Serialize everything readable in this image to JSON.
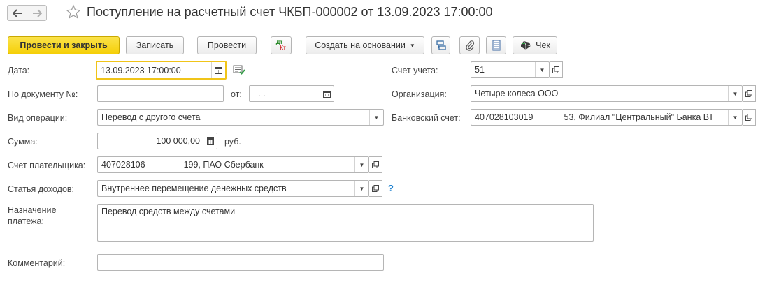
{
  "window": {
    "title": "Поступление на расчетный счет ЧКБП-000002 от 13.09.2023 17:00:00"
  },
  "toolbar": {
    "post_close_label": "Провести и закрыть",
    "save_label": "Записать",
    "post_label": "Провести",
    "dt_label": "Дт",
    "kt_label": "Кт",
    "create_based_label": "Создать на основании",
    "check_label": "Чек"
  },
  "form": {
    "date_label": "Дата:",
    "date_value": "13.09.2023 17:00:00",
    "doc_number_label": "По документу №:",
    "doc_number_value": "",
    "from_label": "от:",
    "from_value": ". .",
    "operation_label": "Вид операции:",
    "operation_value": "Перевод с другого счета",
    "amount_label": "Сумма:",
    "amount_value": "100 000,00",
    "currency": "руб.",
    "payer_account_label": "Счет плательщика:",
    "payer_account_number": "407028106",
    "payer_account_bank": "199, ПАО Сбербанк",
    "income_item_label": "Статья доходов:",
    "income_item_value": "Внутреннее перемещение денежных средств",
    "help_mark": "?",
    "purpose_label": "Назначение платежа:",
    "purpose_value": "Перевод средств между счетами",
    "comment_label": "Комментарий:",
    "comment_value": "",
    "account_label": "Счет учета:",
    "account_value": "51",
    "org_label": "Организация:",
    "org_value": "Четыре колеса ООО",
    "bank_account_label": "Банковский счет:",
    "bank_account_number": "407028103019",
    "bank_account_bank": "53, Филиал \"Центральный\" Банка ВТ"
  },
  "colors": {
    "primary_button": "#f5cf07",
    "focus_border": "#f0c419",
    "help_mark": "#1a7fcf"
  }
}
